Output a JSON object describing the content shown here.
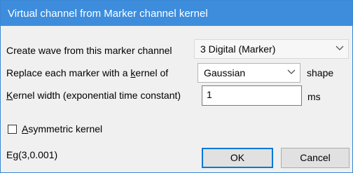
{
  "window": {
    "title": "Virtual channel from Marker channel kernel"
  },
  "row1": {
    "label": "Create wave from this marker channel",
    "select_value": "3 Digital (Marker)"
  },
  "row2": {
    "label_pre": "Replace each marker with a ",
    "label_accel": "k",
    "label_post": "ernel of",
    "select_value": "Gaussian",
    "suffix": "shape"
  },
  "row3": {
    "label_accel": "K",
    "label_post": "ernel width (exponential time constant)",
    "input_value": "1",
    "unit": "ms"
  },
  "checkbox": {
    "label_accel": "A",
    "label_post": "symmetric kernel",
    "checked": false
  },
  "expression": "Eg(3,0.001)",
  "buttons": {
    "ok": "OK",
    "cancel": "Cancel"
  },
  "colors": {
    "title_bar": "#3e8ddd",
    "default_button_border": "#0078d7"
  },
  "icons": {
    "dropdown": "chevron-down-icon"
  }
}
